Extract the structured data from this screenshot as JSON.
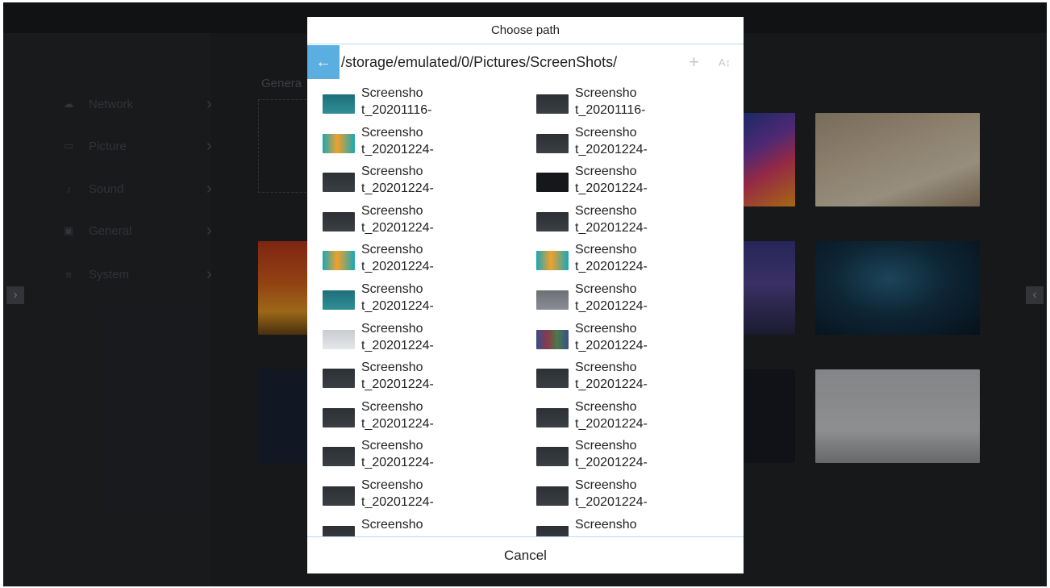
{
  "background": {
    "sidebar": [
      {
        "label": "Network",
        "icon": "network-icon",
        "glyph": "☁"
      },
      {
        "label": "Picture",
        "icon": "picture-icon",
        "glyph": "▭"
      },
      {
        "label": "Sound",
        "icon": "sound-icon",
        "glyph": "♪"
      },
      {
        "label": "General",
        "icon": "general-icon",
        "glyph": "▣"
      },
      {
        "label": "System",
        "icon": "system-icon",
        "glyph": "≡"
      }
    ],
    "section_label": "Genera"
  },
  "dialog": {
    "title": "Choose path",
    "path": "/storage/emulated/0/Pictures/ScreenShots/",
    "cancel_label": "Cancel",
    "colors": {
      "accent": "#5aaee0",
      "divider": "#b9dff0"
    },
    "files": [
      {
        "line1": "Screensho",
        "line2": "t_20201116-",
        "thumb": "teal"
      },
      {
        "line1": "Screensho",
        "line2": "t_20201116-",
        "thumb": "dark"
      },
      {
        "line1": "Screensho",
        "line2": "t_20201224-",
        "thumb": "orange"
      },
      {
        "line1": "Screensho",
        "line2": "t_20201224-",
        "thumb": "dark"
      },
      {
        "line1": "Screensho",
        "line2": "t_20201224-",
        "thumb": "dark"
      },
      {
        "line1": "Screensho",
        "line2": "t_20201224-",
        "thumb": "black"
      },
      {
        "line1": "Screensho",
        "line2": "t_20201224-",
        "thumb": "dark"
      },
      {
        "line1": "Screensho",
        "line2": "t_20201224-",
        "thumb": "dark"
      },
      {
        "line1": "Screensho",
        "line2": "t_20201224-",
        "thumb": "orange"
      },
      {
        "line1": "Screensho",
        "line2": "t_20201224-",
        "thumb": "orange"
      },
      {
        "line1": "Screensho",
        "line2": "t_20201224-",
        "thumb": "teal"
      },
      {
        "line1": "Screensho",
        "line2": "t_20201224-",
        "thumb": "gray"
      },
      {
        "line1": "Screensho",
        "line2": "t_20201224-",
        "thumb": "light"
      },
      {
        "line1": "Screensho",
        "line2": "t_20201224-",
        "thumb": "grid"
      },
      {
        "line1": "Screensho",
        "line2": "t_20201224-",
        "thumb": "dark"
      },
      {
        "line1": "Screensho",
        "line2": "t_20201224-",
        "thumb": "dark"
      },
      {
        "line1": "Screensho",
        "line2": "t_20201224-",
        "thumb": "dark"
      },
      {
        "line1": "Screensho",
        "line2": "t_20201224-",
        "thumb": "dark"
      },
      {
        "line1": "Screensho",
        "line2": "t_20201224-",
        "thumb": "dark"
      },
      {
        "line1": "Screensho",
        "line2": "t_20201224-",
        "thumb": "dark"
      },
      {
        "line1": "Screensho",
        "line2": "t_20201224-",
        "thumb": "dark"
      },
      {
        "line1": "Screensho",
        "line2": "t_20201224-",
        "thumb": "dark"
      },
      {
        "line1": "Screensho",
        "line2": "",
        "thumb": "dark"
      },
      {
        "line1": "Screensho",
        "line2": "",
        "thumb": "dark"
      }
    ]
  }
}
